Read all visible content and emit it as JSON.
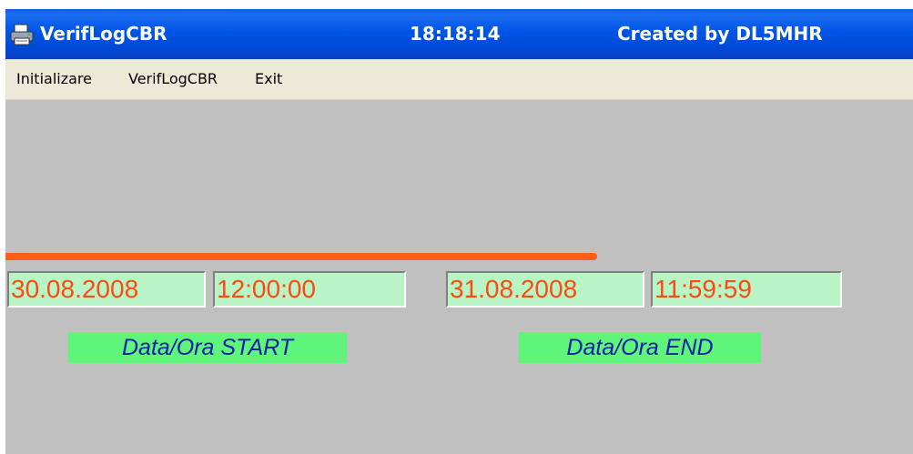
{
  "window": {
    "title": "VerifLogCBR",
    "clock": "18:18:14",
    "credit": "Created by DL5MHR",
    "icon": "printer-app-icon"
  },
  "menu": {
    "items": [
      "Initializare",
      "VerifLogCBR",
      "Exit"
    ]
  },
  "start": {
    "date": "30.08.2008",
    "time": "12:00:00",
    "label": "Data/Ora START"
  },
  "end": {
    "date": "31.08.2008",
    "time": "11:59:59",
    "label": "Data/Ora END"
  },
  "colors": {
    "titlebar": "#0055e6",
    "menubar": "#ece9d8",
    "background": "#c0c0c0",
    "accent_line": "#fe5e18",
    "field_bg": "#b8f4c4",
    "field_text": "#fe4a10",
    "label_bg": "#5ef57a",
    "label_text": "#0a1fa8"
  }
}
